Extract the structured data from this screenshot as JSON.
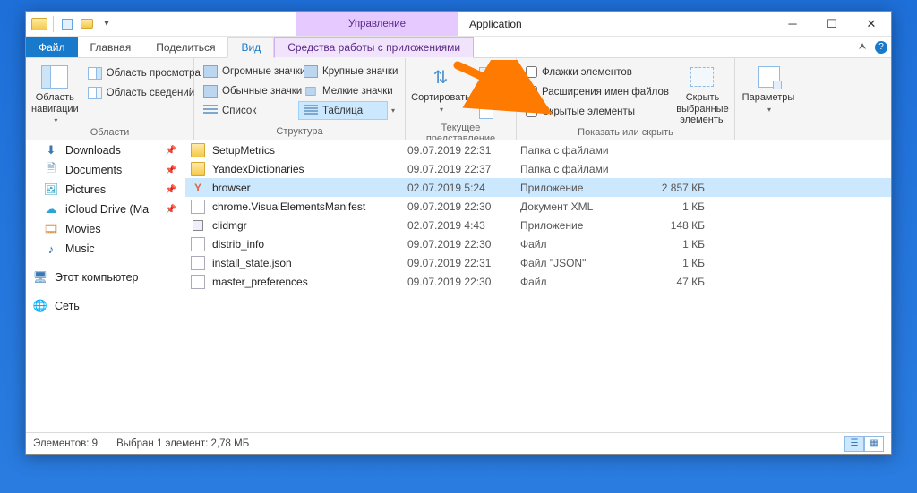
{
  "titlebar": {
    "manage_tab": "Управление",
    "title": "Application"
  },
  "ribbon_tabs": {
    "file": "Файл",
    "home": "Главная",
    "share": "Поделиться",
    "view": "Вид",
    "tools": "Средства работы с приложениями"
  },
  "ribbon": {
    "panes": {
      "nav_pane": "Область навигации",
      "preview_pane": "Область просмотра",
      "details_pane": "Область сведений",
      "group_label": "Области"
    },
    "layout": {
      "xl_icons": "Огромные значки",
      "l_icons": "Крупные значки",
      "m_icons": "Обычные значки",
      "s_icons": "Мелкие значки",
      "list": "Список",
      "details": "Таблица",
      "group_label": "Структура"
    },
    "current_view": {
      "sort": "Сортировать",
      "group_label": "Текущее представление"
    },
    "show_hide": {
      "item_checkboxes": "Флажки элементов",
      "file_ext": "Расширения имен файлов",
      "hidden_items": "Скрытые элементы",
      "hide_selected": "Скрыть выбранные элементы",
      "group_label": "Показать или скрыть"
    },
    "options": {
      "options": "Параметры"
    }
  },
  "nav": {
    "downloads": "Downloads",
    "documents": "Documents",
    "pictures": "Pictures",
    "icloud": "iCloud Drive (Ma",
    "movies": "Movies",
    "music": "Music",
    "this_pc": "Этот компьютер",
    "network": "Сеть"
  },
  "files": [
    {
      "icon": "folder",
      "name": "SetupMetrics",
      "date": "09.07.2019 22:31",
      "type": "Папка с файлами",
      "size": ""
    },
    {
      "icon": "folder",
      "name": "YandexDictionaries",
      "date": "09.07.2019 22:37",
      "type": "Папка с файлами",
      "size": ""
    },
    {
      "icon": "app",
      "name": "browser",
      "date": "02.07.2019 5:24",
      "type": "Приложение",
      "size": "2 857 КБ",
      "selected": true
    },
    {
      "icon": "doc",
      "name": "chrome.VisualElementsManifest",
      "date": "09.07.2019 22:30",
      "type": "Документ XML",
      "size": "1 КБ"
    },
    {
      "icon": "app2",
      "name": "clidmgr",
      "date": "02.07.2019 4:43",
      "type": "Приложение",
      "size": "148 КБ"
    },
    {
      "icon": "doc",
      "name": "distrib_info",
      "date": "09.07.2019 22:30",
      "type": "Файл",
      "size": "1 КБ"
    },
    {
      "icon": "doc",
      "name": "install_state.json",
      "date": "09.07.2019 22:31",
      "type": "Файл \"JSON\"",
      "size": "1 КБ"
    },
    {
      "icon": "doc",
      "name": "master_preferences",
      "date": "09.07.2019 22:30",
      "type": "Файл",
      "size": "47 КБ"
    }
  ],
  "status": {
    "count": "Элементов: 9",
    "selected": "Выбран 1 элемент: 2,78 МБ"
  }
}
